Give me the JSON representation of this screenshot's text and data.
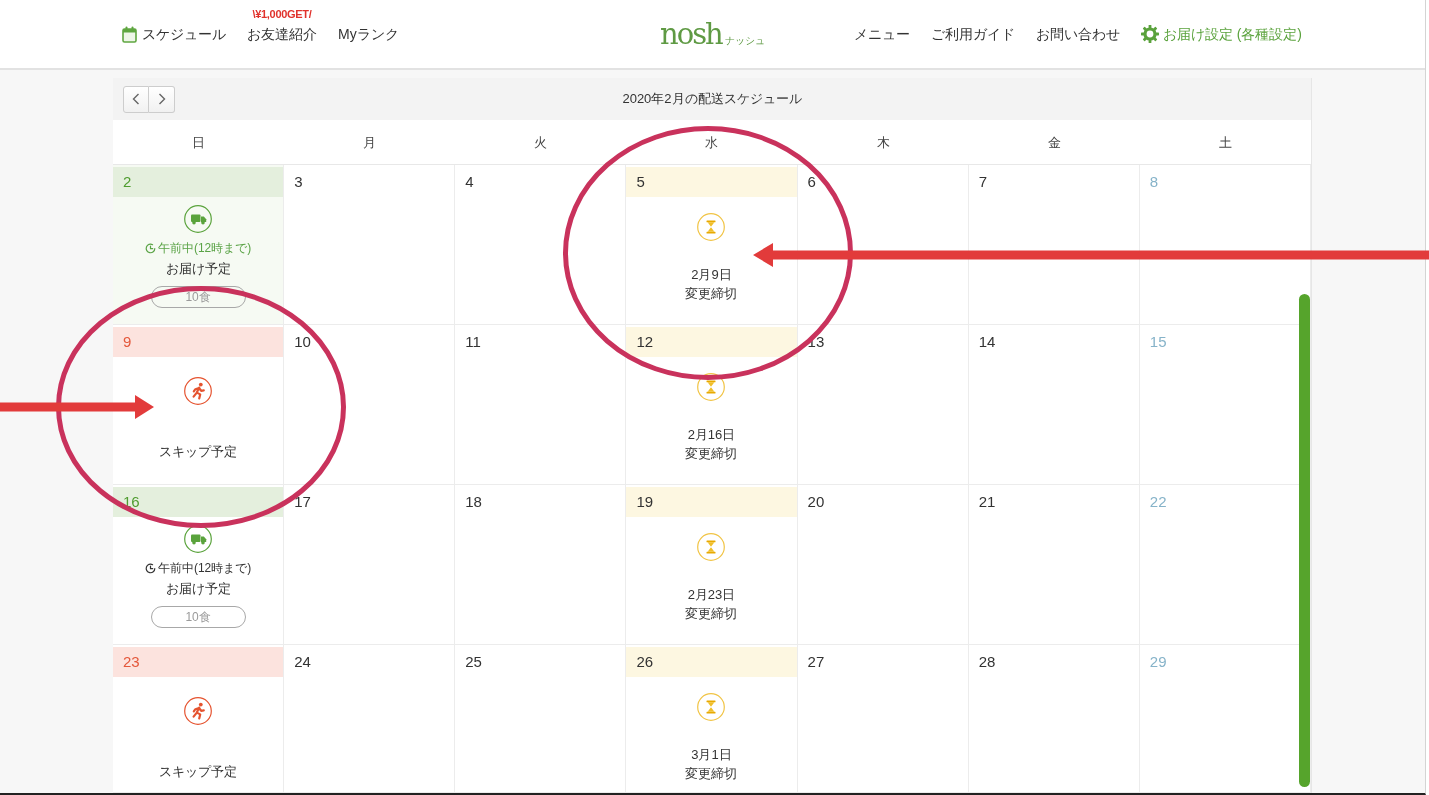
{
  "header": {
    "nav_left": [
      {
        "kind": "schedule",
        "label": "スケジュール"
      },
      {
        "kind": "promo",
        "label": "お友達紹介",
        "badge": "\\¥1,000GET/"
      },
      {
        "kind": "plain",
        "label": "Myランク"
      }
    ],
    "logo": {
      "wordmark": "nosh",
      "kana": "ナッシュ"
    },
    "nav_right": [
      {
        "kind": "plain",
        "label": "メニュー"
      },
      {
        "kind": "plain",
        "label": "ご利用ガイド"
      },
      {
        "kind": "plain",
        "label": "お問い合わせ"
      },
      {
        "kind": "settings",
        "label": "お届け設定 (各種設定)"
      }
    ]
  },
  "calendar": {
    "title": "2020年2月の配送スケジュール",
    "weekdays": [
      "日",
      "月",
      "火",
      "水",
      "木",
      "金",
      "土"
    ],
    "weeks": [
      {
        "days": [
          {
            "date": "2",
            "kind": "delivery",
            "time": "午前中(12時まで)",
            "label": "お届け予定",
            "meals": "10食",
            "current": true
          },
          {
            "date": "3",
            "kind": "plain"
          },
          {
            "date": "4",
            "kind": "plain"
          },
          {
            "date": "5",
            "kind": "deadline",
            "deadline": "2月9日",
            "label": "変更締切"
          },
          {
            "date": "6",
            "kind": "plain"
          },
          {
            "date": "7",
            "kind": "plain"
          },
          {
            "date": "8",
            "kind": "plain"
          }
        ]
      },
      {
        "days": [
          {
            "date": "9",
            "kind": "skip",
            "label": "スキップ予定"
          },
          {
            "date": "10",
            "kind": "plain"
          },
          {
            "date": "11",
            "kind": "plain"
          },
          {
            "date": "12",
            "kind": "deadline",
            "deadline": "2月16日",
            "label": "変更締切"
          },
          {
            "date": "13",
            "kind": "plain"
          },
          {
            "date": "14",
            "kind": "plain"
          },
          {
            "date": "15",
            "kind": "plain"
          }
        ]
      },
      {
        "days": [
          {
            "date": "16",
            "kind": "delivery",
            "time": "午前中(12時まで)",
            "label": "お届け予定",
            "meals": "10食",
            "current": false
          },
          {
            "date": "17",
            "kind": "plain"
          },
          {
            "date": "18",
            "kind": "plain"
          },
          {
            "date": "19",
            "kind": "deadline",
            "deadline": "2月23日",
            "label": "変更締切"
          },
          {
            "date": "20",
            "kind": "plain"
          },
          {
            "date": "21",
            "kind": "plain"
          },
          {
            "date": "22",
            "kind": "plain"
          }
        ]
      },
      {
        "days": [
          {
            "date": "23",
            "kind": "skip",
            "label": "スキップ予定"
          },
          {
            "date": "24",
            "kind": "plain"
          },
          {
            "date": "25",
            "kind": "plain"
          },
          {
            "date": "26",
            "kind": "deadline",
            "deadline": "3月1日",
            "label": "変更締切"
          },
          {
            "date": "27",
            "kind": "plain"
          },
          {
            "date": "28",
            "kind": "plain"
          },
          {
            "date": "29",
            "kind": "plain"
          }
        ]
      }
    ]
  }
}
